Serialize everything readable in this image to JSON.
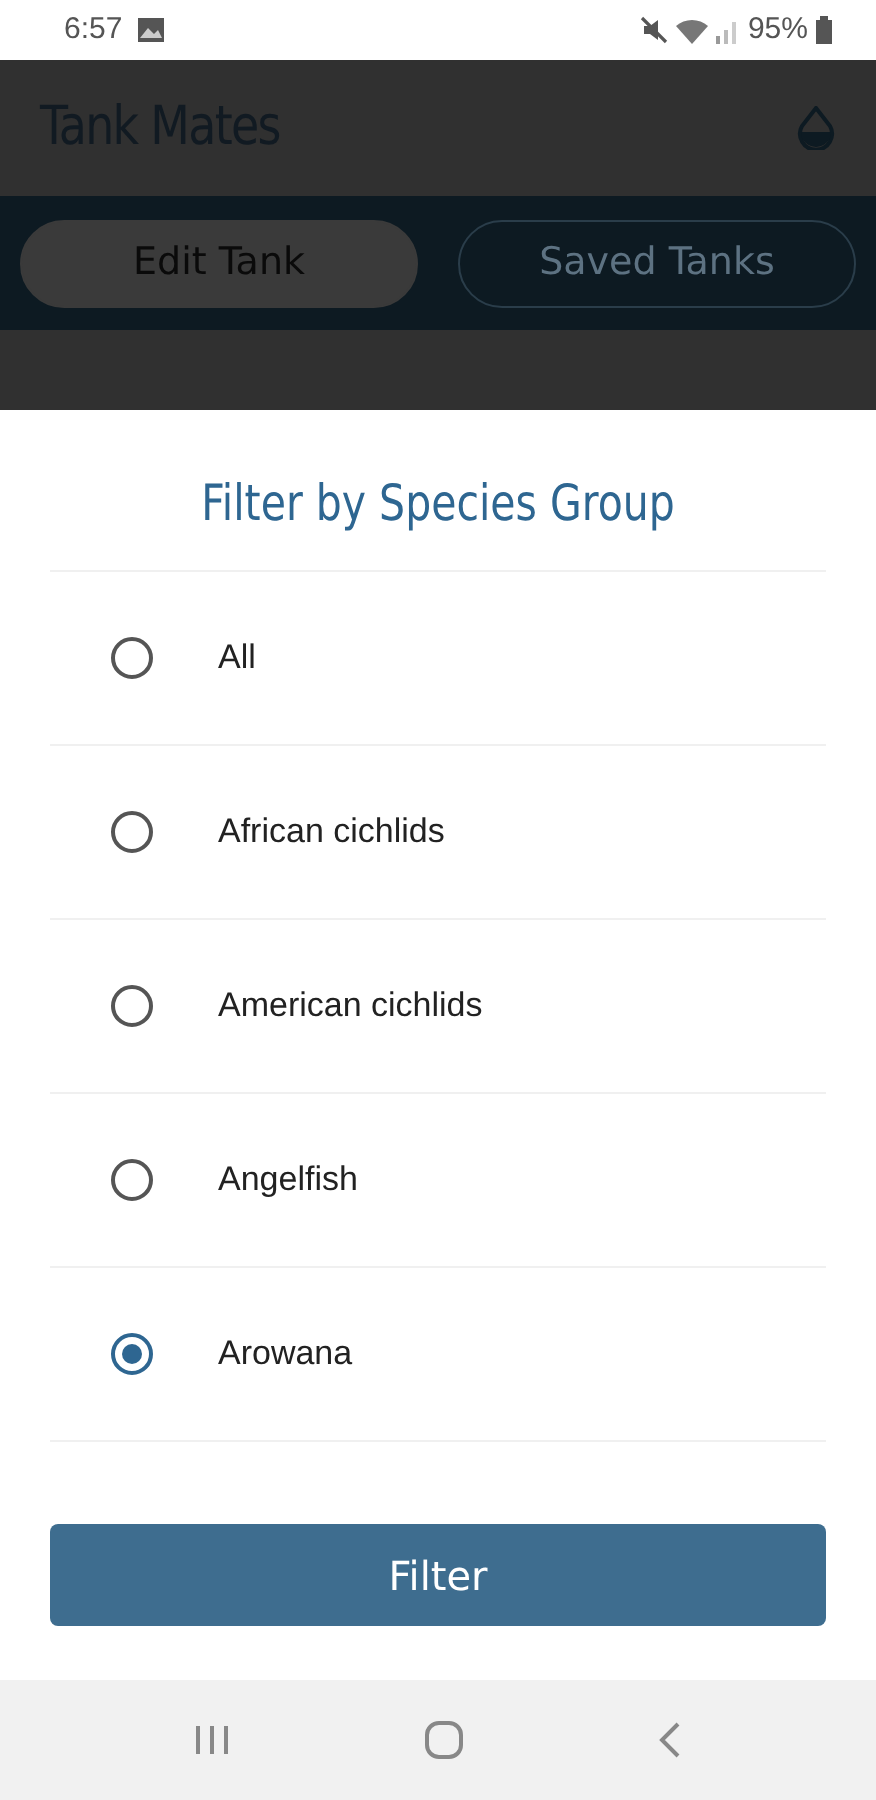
{
  "status_bar": {
    "time": "6:57",
    "battery": "95%"
  },
  "app_bar": {
    "title": "Tank Mates"
  },
  "tabs": [
    {
      "label": "Edit Tank",
      "selected": true
    },
    {
      "label": "Saved Tanks",
      "selected": false
    }
  ],
  "sheet": {
    "title": "Filter by Species Group",
    "options": [
      {
        "label": "All",
        "selected": false
      },
      {
        "label": "African cichlids",
        "selected": false
      },
      {
        "label": "American cichlids",
        "selected": false
      },
      {
        "label": "Angelfish",
        "selected": false
      },
      {
        "label": "Arowana",
        "selected": true
      }
    ],
    "button": "Filter"
  }
}
